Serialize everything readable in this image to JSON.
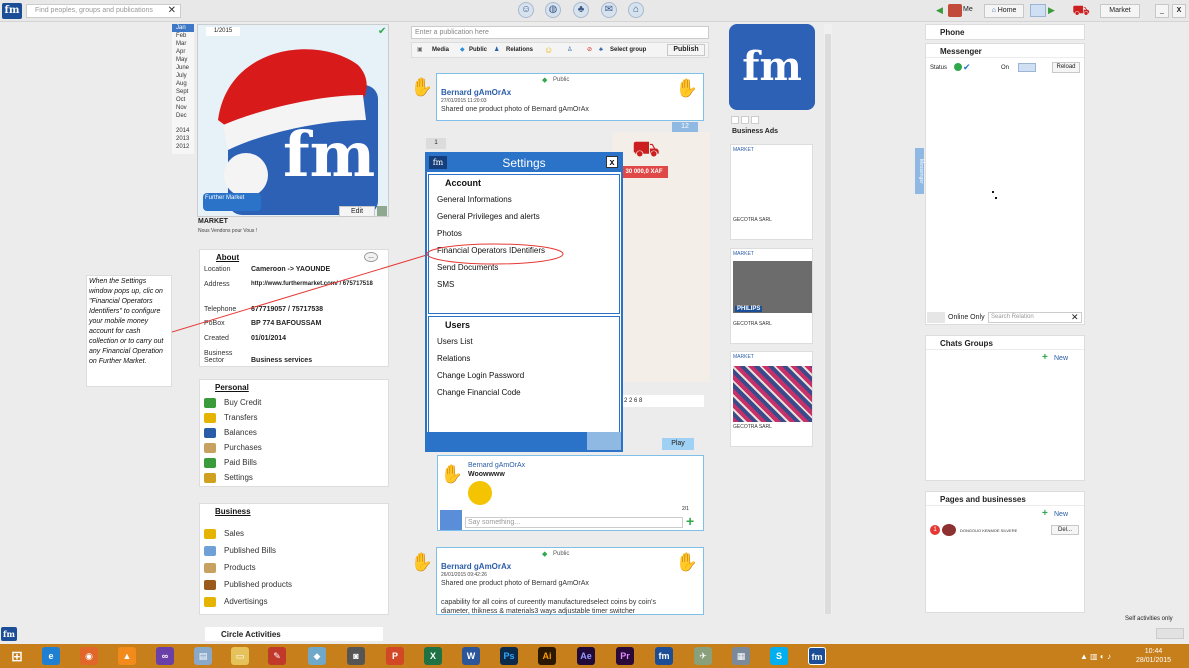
{
  "topbar": {
    "logo": "fm",
    "search_placeholder": "Find peoples, groups and publications",
    "search_clear": "✕",
    "me_label": "Me",
    "home_label": "Home",
    "market_label": "Market",
    "minimize": "_",
    "close": "X"
  },
  "calendar": {
    "months": [
      "Jan",
      "Feb",
      "Mar",
      "Apr",
      "May",
      "June",
      "July",
      "Aug",
      "Sept",
      "Oct",
      "Nov",
      "Dec"
    ],
    "years": [
      "2014",
      "2013",
      "2012"
    ]
  },
  "profile": {
    "badge": "1/2015",
    "card_brand": "fm",
    "card_tagline": "Further Market",
    "edit_label": "Edit",
    "name": "MARKET",
    "tagline": "Nous Vendons pour Vous !"
  },
  "about": {
    "title": "About",
    "more": "...",
    "rows": [
      {
        "k": "Location",
        "v": "Cameroon -> YAOUNDE"
      },
      {
        "k": "Address",
        "v": "http://www.furthermarket.com/ / 675717518"
      },
      {
        "k": "Telephone",
        "v": "677719057 / 75717538"
      },
      {
        "k": "PoBox",
        "v": "BP 774 BAFOUSSAM"
      },
      {
        "k": "Created",
        "v": "01/01/2014"
      },
      {
        "k": "Business Sector",
        "v": "Business services"
      }
    ]
  },
  "personal": {
    "title": "Personal",
    "items": [
      "Buy Credit",
      "Transfers",
      "Balances",
      "Purchases",
      "Paid Bills",
      "Settings"
    ]
  },
  "business": {
    "title": "Business",
    "items": [
      "Sales",
      "Published Bills",
      "Products",
      "Published products",
      "Advertisings"
    ]
  },
  "circle": {
    "title": "Circle Activities"
  },
  "note": {
    "text": "When the Settings window pops up, clic on \"Financial Operators Identifiers\" to configure your mobile money account for cash collection or to carry out any Financial Operation on Further Market."
  },
  "composer": {
    "placeholder": "Enter a publication here",
    "media": "Media",
    "public": "Public",
    "relations": "Relations",
    "select_group": "Select group",
    "publish": "Publish"
  },
  "posts": [
    {
      "visibility": "Public",
      "author": "Bernard gAmOrAx",
      "date": "27/01/2015 11:20:03",
      "text": "Shared one product photo of  Bernard gAmOrAx",
      "count": "12",
      "count2": "2",
      "page": "1"
    },
    {
      "visibility": "Public",
      "author": "Bernard gAmOrAx",
      "date": "26/01/2015 09:42:26",
      "text": "Shared one product photo of  Bernard gAmOrAx",
      "desc": "capability for all coins of cureently manufacturedselect coins by coin's diameter, thikness & materials3 ways adjustable timer switcher"
    }
  ],
  "product": {
    "price": "30 000,0 XAF"
  },
  "comment": {
    "author": "Bernard gAmOrAx",
    "text": "Woowwww",
    "input_placeholder": "Say something...",
    "pager": "2/1",
    "play": "Play",
    "reactions": "2  2  6  8"
  },
  "settings": {
    "title": "Settings",
    "logo": "fm",
    "close": "x",
    "account_title": "Account",
    "account_items": [
      "General Informations",
      "General Privileges and alerts",
      "Photos",
      "Financial Operators IDentifiers",
      "Send Documents",
      "SMS"
    ],
    "users_title": "Users",
    "users_items": [
      "Users List",
      "Relations",
      "Change Login Password",
      "Change Financial Code"
    ]
  },
  "ads": {
    "title": "Business Ads",
    "brand": "fm",
    "items": [
      {
        "market": "MARKET",
        "company": "GECOTRA SARL"
      },
      {
        "market": "MARKET",
        "company": "GECOTRA SARL",
        "product": "PHILIPS"
      },
      {
        "market": "MARKET",
        "company": "GECOTRA SARL"
      }
    ]
  },
  "side_tab": "Messenger",
  "phone": {
    "title": "Phone"
  },
  "messenger": {
    "title": "Messenger",
    "status_label": "Status",
    "on_label": "On",
    "reload": "Reload",
    "online_only": "Online Only",
    "search_placeholder": "Search Relation"
  },
  "chats": {
    "title": "Chats Groups",
    "new": "New"
  },
  "pages": {
    "title": "Pages and businesses",
    "new": "New",
    "entry": "DONGOUO KENMOE SILVERE",
    "entry_badge": "1",
    "del": "Del..."
  },
  "footer": {
    "self_activities": "Self activities only"
  },
  "taskbar": {
    "time": "10:44",
    "date": "28/01/2015"
  },
  "colors": {
    "brand": "#1b4e96",
    "accent": "#2a73c9",
    "taskbar": "#c77f1c",
    "highlight": "#e53935"
  }
}
